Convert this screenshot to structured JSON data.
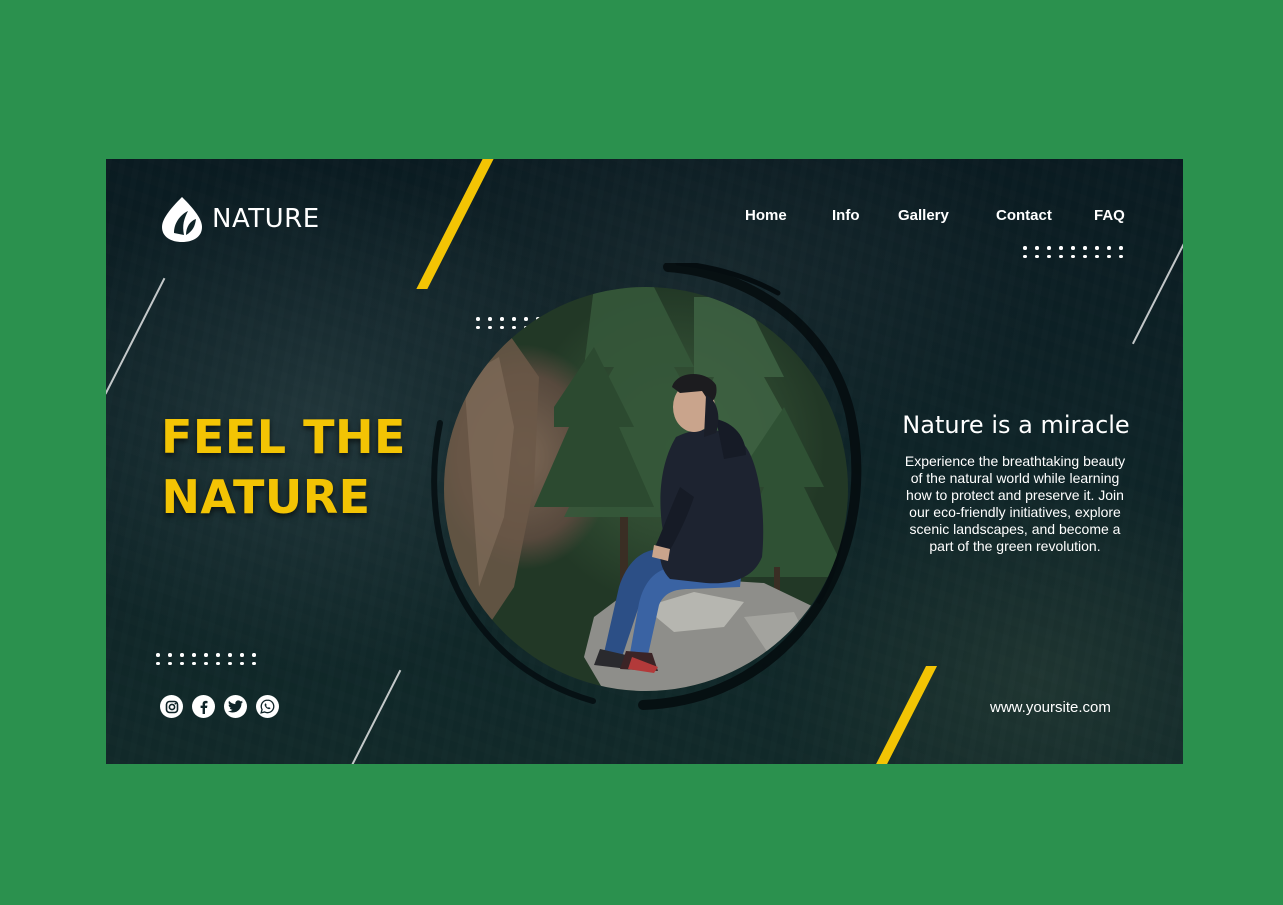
{
  "brand": {
    "name": "NATURE",
    "logo_icon": "leaf-drop-icon"
  },
  "nav": {
    "items": [
      {
        "label": "Home"
      },
      {
        "label": "Info"
      },
      {
        "label": "Gallery"
      },
      {
        "label": "Contact"
      },
      {
        "label": "FAQ"
      }
    ]
  },
  "hero": {
    "headline_line1": "FEEL THE",
    "headline_line2": "NATURE",
    "image_alt": "Man in hooded jacket sitting on a rock facing a pine forest"
  },
  "info": {
    "title": "Nature is a miracle",
    "body": "Experience the breathtaking beauty of the natural world while learning how to protect and preserve it. Join our eco-friendly initiatives, explore scenic landscapes, and become a part of the green revolution."
  },
  "social": {
    "icons": [
      "instagram-icon",
      "facebook-icon",
      "twitter-icon",
      "whatsapp-icon"
    ]
  },
  "footer": {
    "website": "www.yoursite.com"
  },
  "colors": {
    "page_background": "#2b914e",
    "hero_background": "#0f2428",
    "accent_yellow": "#f3c404",
    "text_white": "#ffffff"
  }
}
